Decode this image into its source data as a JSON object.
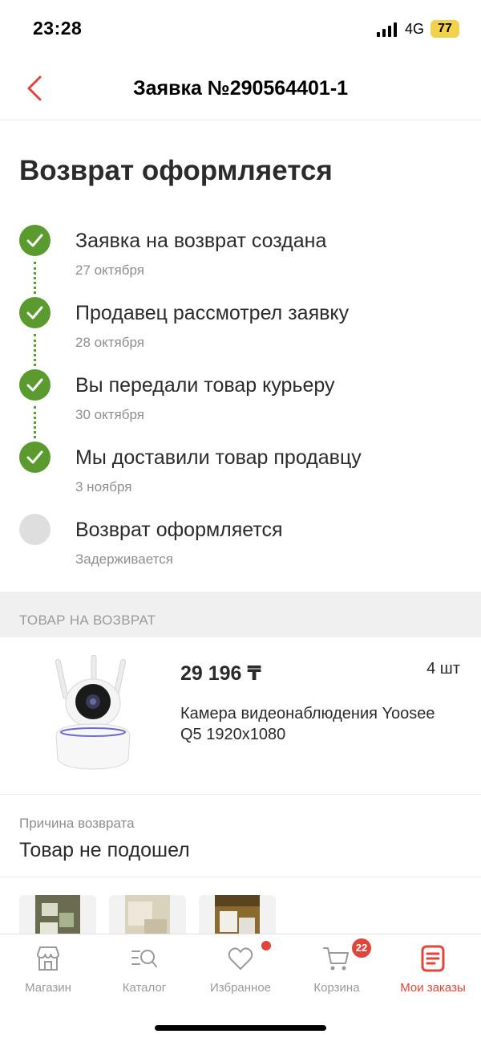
{
  "status_bar": {
    "time": "23:28",
    "network": "4G",
    "battery": "77"
  },
  "header": {
    "title": "Заявка №290564401-1"
  },
  "page_title": "Возврат оформляется",
  "timeline": [
    {
      "label": "Заявка на возврат создана",
      "date": "27 октября",
      "done": true
    },
    {
      "label": "Продавец рассмотрел заявку",
      "date": "28 октября",
      "done": true
    },
    {
      "label": "Вы передали товар курьеру",
      "date": "30 октября",
      "done": true
    },
    {
      "label": "Мы доставили товар продавцу",
      "date": "3 ноября",
      "done": true
    },
    {
      "label": "Возврат оформляется",
      "date": "Задерживается",
      "done": false
    }
  ],
  "section": {
    "title": "ТОВАР НА ВОЗВРАТ"
  },
  "product": {
    "price": "29 196 ₸",
    "quantity": "4 шт",
    "name": "Камера видеонаблюдения Yoosee Q5 1920x1080"
  },
  "reason": {
    "label": "Причина возврата",
    "value": "Товар не подошел"
  },
  "tabs": [
    {
      "label": "Магазин",
      "icon": "store-icon"
    },
    {
      "label": "Каталог",
      "icon": "catalog-search-icon"
    },
    {
      "label": "Избранное",
      "icon": "heart-icon"
    },
    {
      "label": "Корзина",
      "icon": "cart-icon"
    },
    {
      "label": "Мои заказы",
      "icon": "orders-icon"
    }
  ],
  "cart_badge": "22",
  "colors": {
    "accent": "#e0443a",
    "success": "#5a9a2f",
    "muted": "#8e8e8e"
  }
}
